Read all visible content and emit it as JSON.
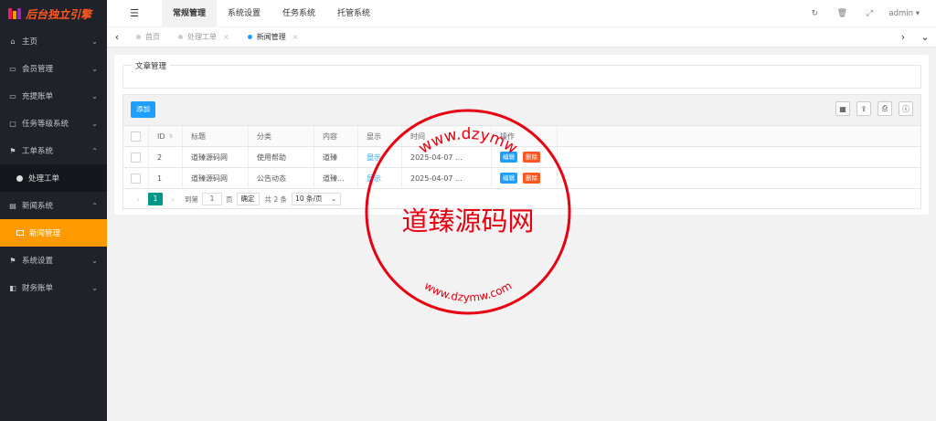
{
  "brand": {
    "title": "后台独立引擎"
  },
  "sidebar": {
    "items": [
      {
        "icon": "home-icon",
        "label": "主页"
      },
      {
        "icon": "member-icon",
        "label": "会员管理"
      },
      {
        "icon": "bill-icon",
        "label": "充提账单"
      },
      {
        "icon": "monitor-icon",
        "label": "任务等级系统"
      },
      {
        "icon": "flag-icon",
        "label": "工单系统",
        "expanded": true,
        "sub": [
          {
            "label": "处理工单"
          }
        ]
      },
      {
        "icon": "news-icon",
        "label": "新闻系统",
        "expanded": true,
        "sub": [
          {
            "label": "新闻管理",
            "active": true
          }
        ]
      },
      {
        "icon": "flag-icon",
        "label": "系统设置"
      },
      {
        "icon": "finance-icon",
        "label": "财务账单"
      }
    ]
  },
  "topnav": {
    "tabs": [
      "常规管理",
      "系统设置",
      "任务系统",
      "托管系统"
    ],
    "active": 0,
    "user": "admin"
  },
  "tabs": [
    {
      "label": "首页",
      "closable": false
    },
    {
      "label": "处理工单",
      "closable": true
    },
    {
      "label": "新闻管理",
      "closable": true,
      "active": true
    }
  ],
  "main": {
    "section_title": "文章管理",
    "add_button": "添加",
    "columns": [
      "ID",
      "标题",
      "分类",
      "内容",
      "显示",
      "时间",
      "操作"
    ],
    "rows": [
      {
        "id": "2",
        "title": "道臻源码网",
        "category": "使用帮助",
        "content": "道臻",
        "show": "显示",
        "time": "2025-04-07 ...",
        "edit": "编辑",
        "delete": "删除"
      },
      {
        "id": "1",
        "title": "道臻源码网",
        "category": "公告动态",
        "content": "道臻...",
        "show": "显示",
        "time": "2025-04-07 ...",
        "edit": "编辑",
        "delete": "删除"
      }
    ],
    "pager": {
      "current": "1",
      "goto_label": "到第",
      "goto_value": "1",
      "page_unit": "页",
      "confirm": "确定",
      "total": "共 2 条",
      "page_size": "10 条/页"
    }
  },
  "watermark": {
    "center_text": "道臻源码网",
    "ring_text_top": "www.dzymw",
    "ring_text_bottom": "www.dzymw.com",
    "color": "#e60012"
  },
  "colors": {
    "accent": "#1e9fff",
    "danger": "#ff5722",
    "active_nav": "#ff9a00",
    "pager": "#009688"
  }
}
